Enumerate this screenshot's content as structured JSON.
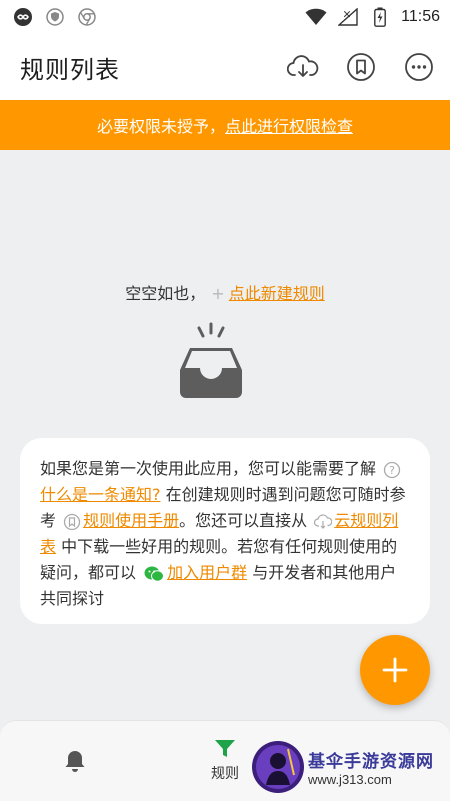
{
  "status_bar": {
    "time": "11:56"
  },
  "app_bar": {
    "title": "规则列表",
    "icons": [
      "cloud-download-icon",
      "bookmark-icon",
      "more-icon"
    ]
  },
  "banner": {
    "text_prefix": "必要权限未授予，",
    "link": "点此进行权限检查",
    "color": "#ff9800"
  },
  "empty_state": {
    "text": "空空如也，",
    "plus": "+",
    "link": "点此新建规则"
  },
  "help_card": {
    "t1": "如果您是第一次使用此应用，您可以能需要了解",
    "link1": "什么是一条通知?",
    "t2": "在创建规则时遇到问题您可随时参考",
    "link2": "规则使用手册",
    "t3": "。您还可以直接从",
    "link3": "云规则列表",
    "t4": "中下载一些好用的规则。若您有任何规则使用的疑问，都可以",
    "link4": "加入用户群",
    "t5": "与开发者和其他用户共同探讨"
  },
  "fab": {
    "label": "+"
  },
  "bottom_nav": {
    "items": [
      {
        "icon": "bell-icon",
        "label": ""
      },
      {
        "icon": "filter-icon",
        "label": "规则",
        "active": true
      }
    ],
    "accent": "#1fa34a"
  },
  "watermark": {
    "title": "基伞手游资源网",
    "url": "www.j313.com"
  },
  "colors": {
    "accent": "#ff9800",
    "link": "#ef8a00"
  }
}
